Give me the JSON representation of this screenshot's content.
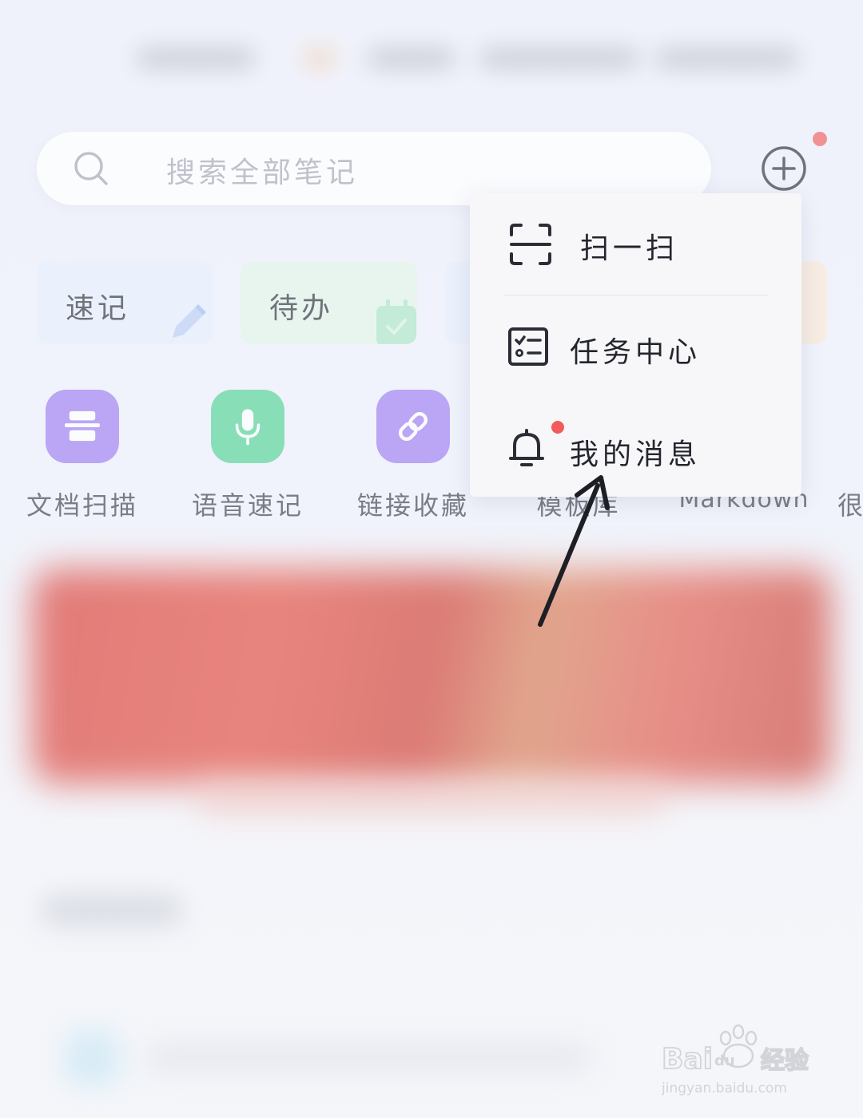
{
  "search": {
    "placeholder": "搜索全部笔记"
  },
  "header": {
    "add_icon": "plus-circle-icon",
    "notification_dot_color": "#f25b5b"
  },
  "quick_cards": [
    {
      "label": "速记",
      "icon": "pencil-icon",
      "color": "#e6eefc"
    },
    {
      "label": "待办",
      "icon": "calendar-check-icon",
      "color": "#e2f5e9"
    }
  ],
  "features": [
    {
      "label": "文档扫描",
      "icon": "scanner-icon",
      "color": "#9b7cf1"
    },
    {
      "label": "语音速记",
      "icon": "microphone-icon",
      "color": "#4fd392"
    },
    {
      "label": "链接收藏",
      "icon": "link-icon",
      "color": "#9b7cf1"
    },
    {
      "label": "模板库",
      "icon": "template-icon"
    },
    {
      "label": "Markdown",
      "icon": "markdown-icon"
    },
    {
      "label": "很",
      "icon": "unknown-icon"
    }
  ],
  "popup_menu": {
    "items": [
      {
        "label": "扫一扫",
        "icon": "scan-icon"
      },
      {
        "label": "任务中心",
        "icon": "task-list-icon"
      },
      {
        "label": "我的消息",
        "icon": "bell-icon",
        "has_badge": true
      }
    ]
  },
  "watermark": {
    "brand": "Baidu经验",
    "url": "jingyan.baidu.com"
  }
}
